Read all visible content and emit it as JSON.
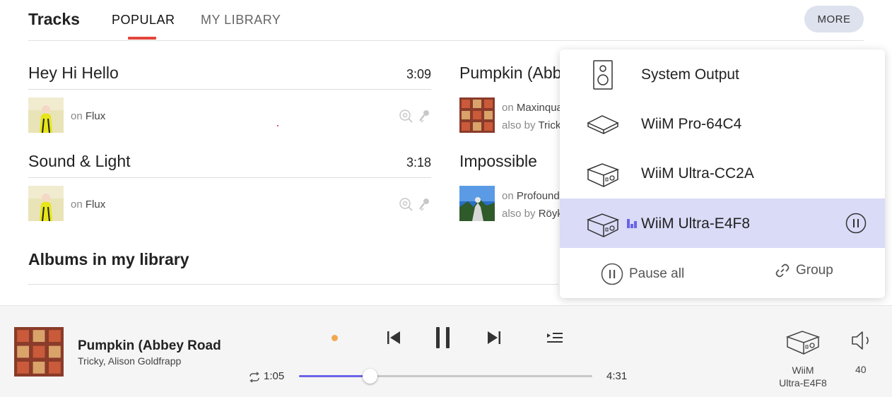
{
  "header": {
    "title": "Tracks",
    "tabs": [
      {
        "label": "POPULAR",
        "active": true
      },
      {
        "label": "MY LIBRARY",
        "active": false
      }
    ],
    "more_label": "MORE"
  },
  "tracks": [
    {
      "name": "Hey Hi Hello",
      "duration": "3:09",
      "on_label": "on",
      "album": "Flux"
    },
    {
      "name": "Pumpkin (Abbey Road",
      "on_label": "on",
      "album": "Maxinquaye",
      "also_label": "also by",
      "also_artist": "Tricky"
    },
    {
      "name": "Sound & Light",
      "duration": "3:18",
      "on_label": "on",
      "album": "Flux"
    },
    {
      "name": "Impossible",
      "on_label": "on",
      "album": "Profound",
      "also_label": "also by",
      "also_artist": "Röyksopp"
    }
  ],
  "albums_section": {
    "title": "Albums in my library"
  },
  "device_menu": {
    "devices": [
      {
        "name": "System Output",
        "icon": "speaker-icon",
        "active": false
      },
      {
        "name": "WiiM Pro-64C4",
        "icon": "wiim-pro-icon",
        "active": false
      },
      {
        "name": "WiiM Ultra-CC2A",
        "icon": "wiim-ultra-icon",
        "active": false
      },
      {
        "name": "WiiM Ultra-E4F8",
        "icon": "wiim-ultra-icon",
        "active": true
      }
    ],
    "pause_all_label": "Pause all",
    "group_label": "Group"
  },
  "player": {
    "title": "Pumpkin (Abbey Road",
    "artist": "Tricky, Alison Goldfrapp",
    "elapsed": "1:05",
    "total": "4:31",
    "progress": 0.24,
    "device_name_line1": "WiiM",
    "device_name_line2": "Ultra-E4F8",
    "volume": "40"
  },
  "colors": {
    "accent": "#6b63e8",
    "tab_underline": "#e2453c",
    "active_row": "#d9dbf7",
    "more_button": "#dde2ee"
  }
}
